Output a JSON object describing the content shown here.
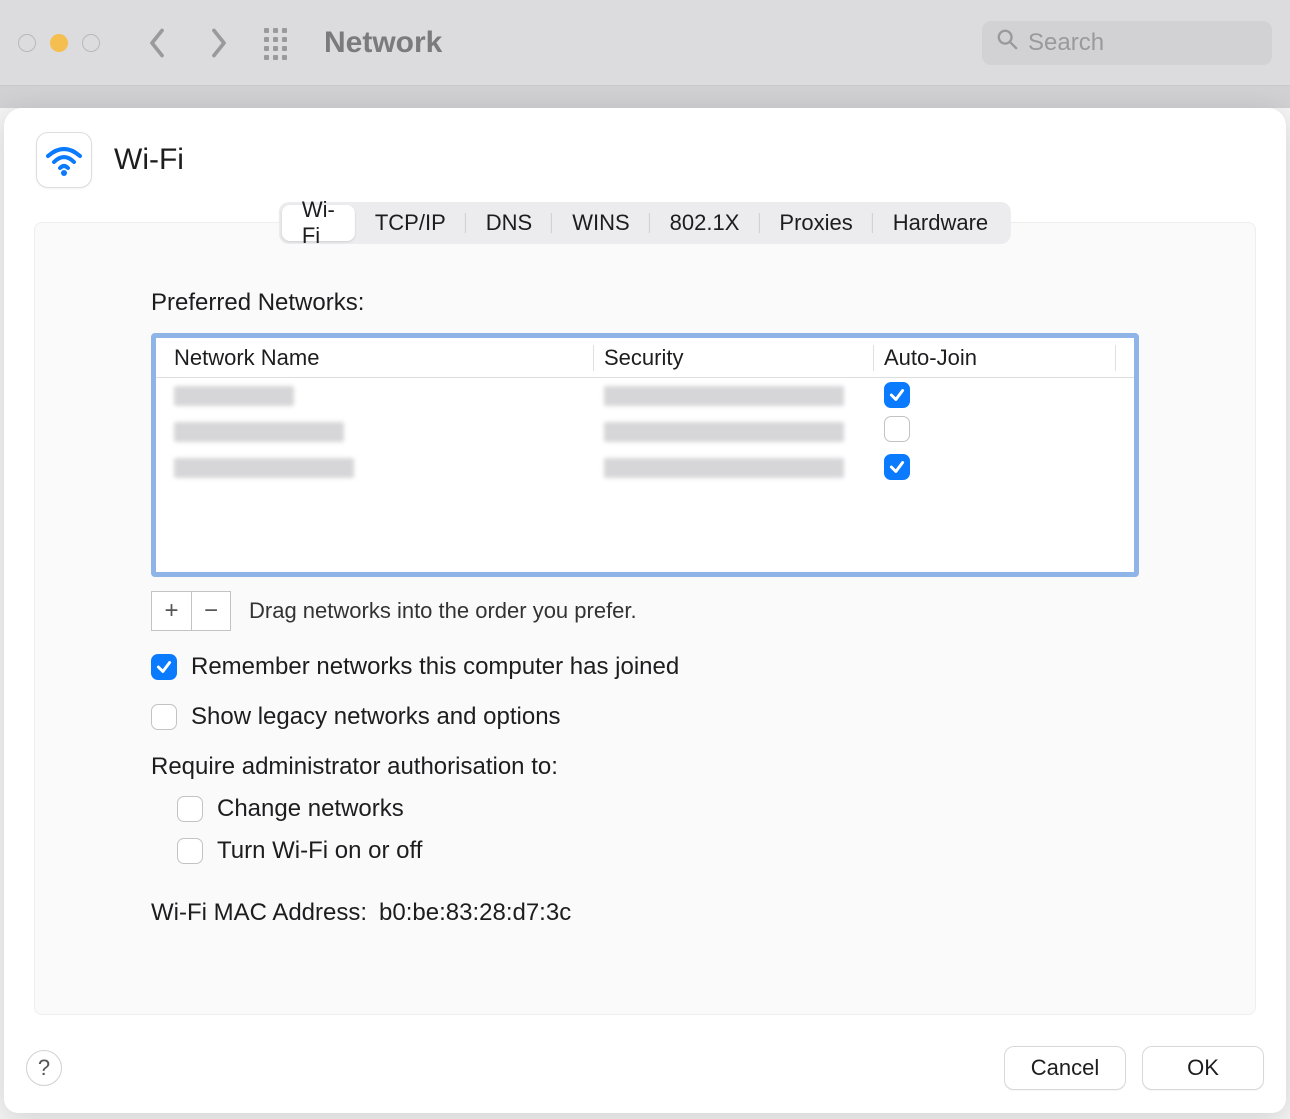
{
  "toolbar": {
    "title": "Network",
    "search_placeholder": "Search"
  },
  "sheet": {
    "icon": "wifi-icon",
    "title": "Wi-Fi"
  },
  "tabs": [
    {
      "label": "Wi-Fi",
      "active": true
    },
    {
      "label": "TCP/IP",
      "active": false
    },
    {
      "label": "DNS",
      "active": false
    },
    {
      "label": "WINS",
      "active": false
    },
    {
      "label": "802.1X",
      "active": false
    },
    {
      "label": "Proxies",
      "active": false
    },
    {
      "label": "Hardware",
      "active": false
    }
  ],
  "preferred_networks": {
    "label": "Preferred Networks:",
    "columns": {
      "name": "Network Name",
      "security": "Security",
      "autojoin": "Auto-Join"
    },
    "rows": [
      {
        "name_redacted": true,
        "security_redacted": true,
        "autojoin": true
      },
      {
        "name_redacted": true,
        "security_redacted": true,
        "autojoin": false
      },
      {
        "name_redacted": true,
        "security_redacted": true,
        "autojoin": true
      }
    ],
    "drag_hint": "Drag networks into the order you prefer."
  },
  "options": {
    "remember": {
      "label": "Remember networks this computer has joined",
      "checked": true
    },
    "legacy": {
      "label": "Show legacy networks and options",
      "checked": false
    },
    "admin_label": "Require administrator authorisation to:",
    "admin_change": {
      "label": "Change networks",
      "checked": false
    },
    "admin_toggle": {
      "label": "Turn Wi-Fi on or off",
      "checked": false
    }
  },
  "mac": {
    "label": "Wi-Fi MAC Address:",
    "value": "b0:be:83:28:d7:3c"
  },
  "buttons": {
    "help": "?",
    "cancel": "Cancel",
    "ok": "OK"
  }
}
